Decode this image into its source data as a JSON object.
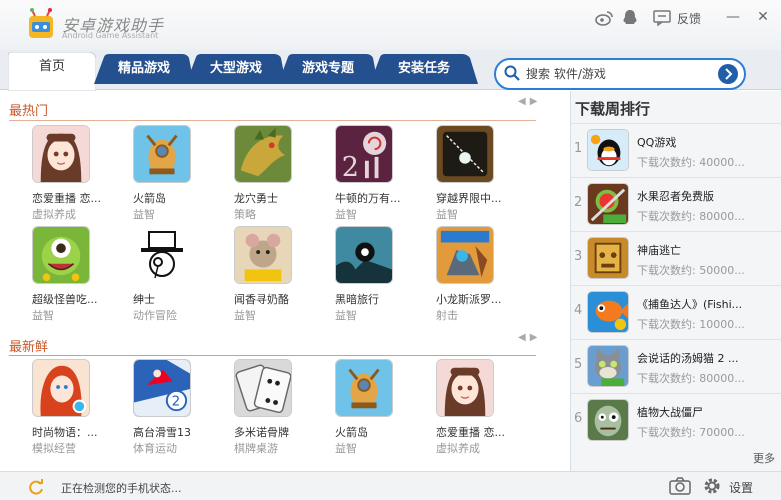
{
  "app": {
    "name": "安卓游戏助手",
    "subtitle": "Android Game Assistant"
  },
  "titlebar": {
    "feedback": "反馈",
    "minimize": "—",
    "close": "✕"
  },
  "tabs": [
    {
      "label": "首页"
    },
    {
      "label": "精品游戏"
    },
    {
      "label": "大型游戏"
    },
    {
      "label": "游戏专题"
    },
    {
      "label": "安装任务"
    }
  ],
  "search": {
    "placeholder": "搜索 软件/游戏"
  },
  "hot": {
    "title": "最热门",
    "pager": "◀▶",
    "apps": [
      {
        "name": "恋爱重播 恋...",
        "category": "虚拟养成"
      },
      {
        "name": "火箭岛",
        "category": "益智"
      },
      {
        "name": "龙穴勇士",
        "category": "策略"
      },
      {
        "name": "牛顿的万有...",
        "category": "益智"
      },
      {
        "name": "穿越界限中...",
        "category": "益智"
      },
      {
        "name": "超级怪兽吃...",
        "category": "益智"
      },
      {
        "name": "绅士",
        "category": "动作冒险"
      },
      {
        "name": "闻香寻奶酪",
        "category": "益智"
      },
      {
        "name": "黑暗旅行",
        "category": "益智"
      },
      {
        "name": "小龙斯派罗...",
        "category": "射击"
      }
    ]
  },
  "fresh": {
    "title": "最新鲜",
    "pager": "◀▶",
    "apps": [
      {
        "name": "时尚物语：...",
        "category": "模拟经营"
      },
      {
        "name": "高台滑雪13",
        "category": "体育运动"
      },
      {
        "name": "多米诺骨牌",
        "category": "棋牌桌游"
      },
      {
        "name": "火箭岛",
        "category": "益智"
      },
      {
        "name": "恋爱重播 恋...",
        "category": "虚拟养成"
      }
    ]
  },
  "ranking": {
    "title": "下载周排行",
    "more": "更多",
    "items": [
      {
        "rank": "1",
        "name": "QQ游戏",
        "downloads": "下载次数约: 40000..."
      },
      {
        "rank": "2",
        "name": "水果忍者免费版",
        "downloads": "下载次数约: 80000..."
      },
      {
        "rank": "3",
        "name": "神庙逃亡",
        "downloads": "下载次数约: 50000..."
      },
      {
        "rank": "4",
        "name": "《捕鱼达人》(Fishi...",
        "downloads": "下载次数约: 10000..."
      },
      {
        "rank": "5",
        "name": "会说话的汤姆猫 2 ...",
        "downloads": "下载次数约: 80000..."
      },
      {
        "rank": "6",
        "name": "植物大战僵尸",
        "downloads": "下载次数约: 70000..."
      }
    ]
  },
  "status": {
    "text": "正在检测您的手机状态...",
    "settings": "设置"
  },
  "icons": [
    "weibo-icon",
    "qq-icon",
    "feedback-icon",
    "search-icon",
    "arrow-right-icon",
    "refresh-icon",
    "camera-icon",
    "gear-icon"
  ],
  "colors": {
    "accent": "#1f5ea8",
    "tab": "#24508f",
    "section": "#c9572a",
    "hot_line": "#e3b09a",
    "fresh_line": "#8fb0d8"
  }
}
